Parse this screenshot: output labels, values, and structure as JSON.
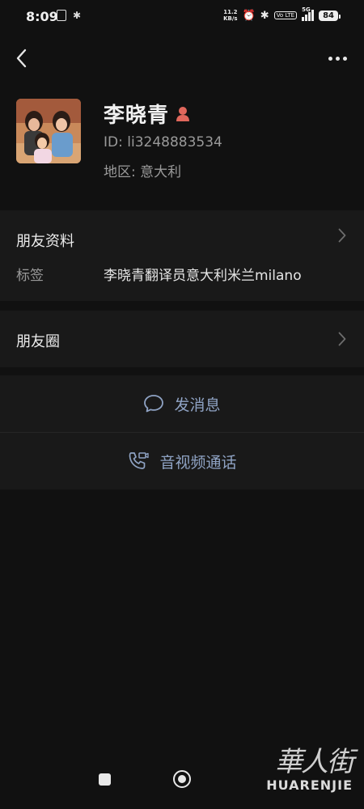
{
  "status_bar": {
    "time": "8:09",
    "net_speed_value": "11.2",
    "net_speed_unit": "KB/s",
    "volte": "Vo LTE",
    "signal": "5G",
    "battery": "84"
  },
  "profile": {
    "name": "李晓青",
    "id_label": "ID:",
    "id_value": "li3248883534",
    "region_label": "地区:",
    "region_value": "意大利"
  },
  "friend_info": {
    "title": "朋友资料",
    "tag_label": "标签",
    "tag_value": "李晓青翻译员意大利米兰milano"
  },
  "moments": {
    "title": "朋友圈"
  },
  "actions": {
    "message_label": "发消息",
    "call_label": "音视频通话"
  },
  "watermark": {
    "chars": "華人街",
    "latin": "HUARENJIE"
  },
  "colors": {
    "background": "#111111",
    "card": "#191919",
    "action_text": "#8fa3c4",
    "gender_icon": "#e0675c"
  }
}
